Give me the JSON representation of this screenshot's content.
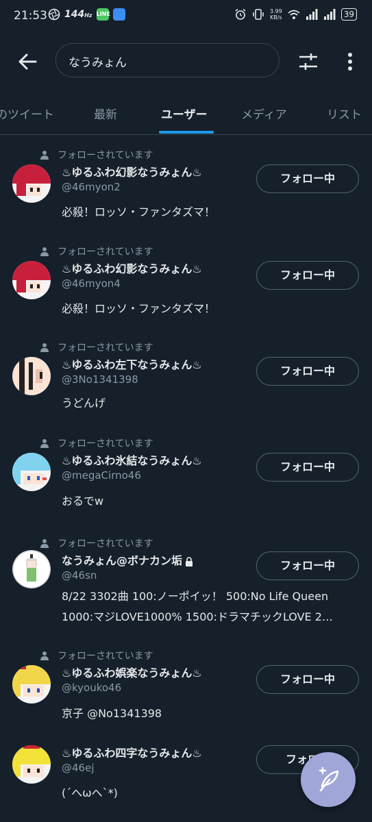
{
  "status_bar": {
    "time": "21:53",
    "refresh_rate": "144",
    "refresh_unit": "Hz",
    "line_label": "LINE",
    "net_speed_value": "3.99",
    "net_speed_unit": "KB/s",
    "battery": "39"
  },
  "header": {
    "search_query": "なうみょん"
  },
  "tabs": [
    {
      "label": "のツイート"
    },
    {
      "label": "最新"
    },
    {
      "label": "ユーザー"
    },
    {
      "label": "メディア"
    },
    {
      "label": "リスト"
    }
  ],
  "colors": {
    "background": "#15202b",
    "accent": "#1d9bf0",
    "fab": "#a1a6d8"
  },
  "users": [
    {
      "followed_text": "フォローされています",
      "name": "♨ゆるふわ幻影なうみょん♨",
      "handle": "@46myon2",
      "bio": "必殺！ロッソ・ファンタズマ！",
      "follow_label": "フォロー中"
    },
    {
      "followed_text": "フォローされています",
      "name": "♨ゆるふわ幻影なうみょん♨",
      "handle": "@46myon4",
      "bio": "必殺！ロッソ・ファンタズマ！",
      "follow_label": "フォロー中"
    },
    {
      "followed_text": "フォローされています",
      "name": "♨ゆるふわ左下なうみょん♨",
      "handle": "@3No1341398",
      "bio": "うどんげ",
      "follow_label": "フォロー中"
    },
    {
      "followed_text": "フォローされています",
      "name": "♨ゆるふわ氷結なうみょん♨",
      "handle": "@megaCirno46",
      "bio": "おるでw",
      "follow_label": "フォロー中"
    },
    {
      "name": "なうみょん@ボナカン垢",
      "handle": "@46sn",
      "bio_line1": "8/22 3302曲 100:ノーポイッ！ 500:No Life Queen",
      "bio_line2": "1000:マジLOVE1000% 1500:ドラマチックLOVE 2…",
      "follow_label": "フォロー中"
    },
    {
      "followed_text": "フォローされています",
      "name": "♨ゆるふわ娯楽なうみょん♨",
      "handle": "@kyouko46",
      "bio": "京子 @No1341398",
      "follow_label": "フォロー中"
    },
    {
      "name": "♨ゆるふわ四字なうみょん♨",
      "handle": "@46ej",
      "bio": "(´へωへ`*)",
      "follow_label": "フォロー"
    }
  ]
}
